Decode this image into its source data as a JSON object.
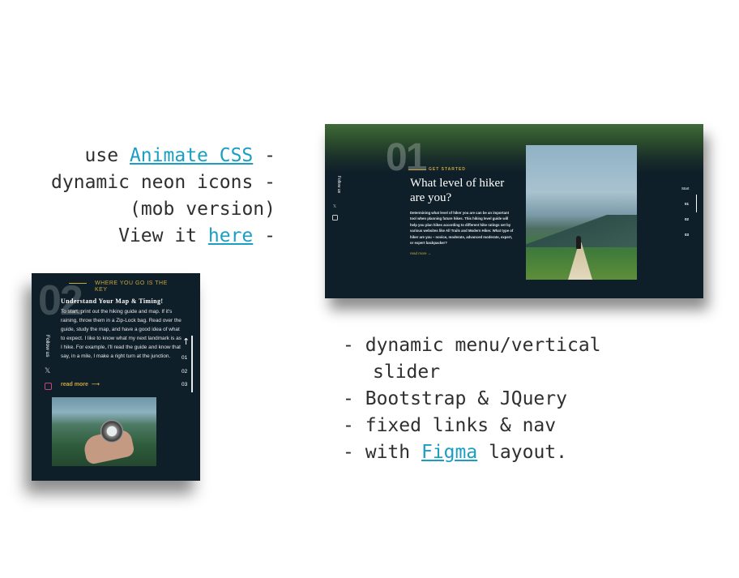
{
  "description": {
    "line1_prefix": "use",
    "line1_link": "Animate CSS",
    "line1_suffix": "-",
    "line2": "dynamic neon icons -",
    "line3": "(mob version)",
    "line4_prefix": "View it",
    "line4_link": "here",
    "line4_suffix": "-"
  },
  "desktop": {
    "number": "01",
    "eyebrow": "GET STARTED",
    "title": "What level of hiker are you?",
    "body": "Determining what level of hiker you are can be an important tool when planning future hikes. This hiking level guide will help you plan hikes according to different hike ratings set by various websites like All Trails and Modern Hiker. What type of hiker are you – novice, moderate, advanced moderate, expert, or expert backpacker?",
    "read_more": "read more →",
    "follow": "Follow us",
    "nav": {
      "start": "Start",
      "items": [
        "01",
        "02",
        "03"
      ]
    }
  },
  "mobile": {
    "number": "02",
    "eyebrow": "WHERE YOU GO IS THE KEY",
    "title": "Understand Your Map & Timing!",
    "body": "To start, print out the hiking guide and map. If it's raining, throw them in a Zip-Lock bag. Read over the guide, study the map, and have a good idea of what to expect. I like to know what my next landmark is as I hike. For example, I'll read the guide and know that say, in a mile, I make a right turn at the junction.",
    "read_more": "read more",
    "read_more_arrow": "⟶",
    "follow": "Follow us",
    "up_arrow": "↑",
    "nav_items": [
      "01",
      "02",
      "03"
    ]
  },
  "bullets": [
    {
      "dash": "-",
      "text": "dynamic menu/vertical",
      "cont": "slider"
    },
    {
      "dash": "-",
      "text": "Bootstrap & JQuery"
    },
    {
      "dash": "-",
      "text": "fixed links & nav"
    },
    {
      "dash": "-",
      "text_prefix": "with ",
      "link": "Figma",
      "text_suffix": " layout."
    }
  ],
  "icons": {
    "social_x": "x-icon",
    "social_instagram": "instagram-icon",
    "arrow_up": "arrow-up-icon",
    "arrow_right": "arrow-right-icon"
  },
  "colors": {
    "link": "#1a9ec3",
    "panel_bg": "#0f1f29",
    "accent_gold": "#c9a640",
    "text": "#2f2f2f"
  }
}
